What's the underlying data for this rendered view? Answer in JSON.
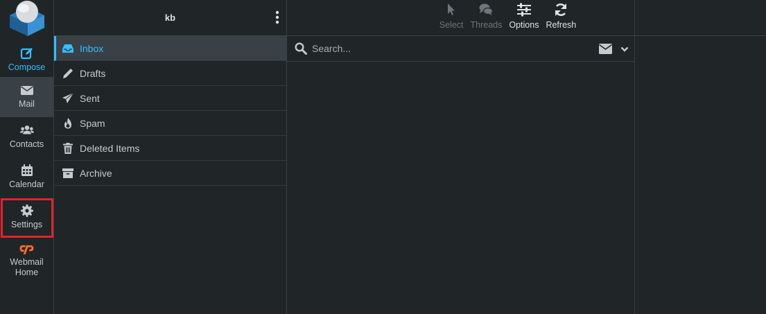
{
  "nav": {
    "compose": "Compose",
    "mail": "Mail",
    "contacts": "Contacts",
    "calendar": "Calendar",
    "settings": "Settings",
    "webmail_home": "Webmail\nHome"
  },
  "folders": {
    "title": "kb",
    "items": [
      {
        "label": "Inbox",
        "icon": "inbox-icon",
        "selected": true
      },
      {
        "label": "Drafts",
        "icon": "pencil-icon"
      },
      {
        "label": "Sent",
        "icon": "paper-plane-icon"
      },
      {
        "label": "Spam",
        "icon": "fire-icon"
      },
      {
        "label": "Deleted Items",
        "icon": "trash-icon"
      },
      {
        "label": "Archive",
        "icon": "archive-box-icon"
      }
    ]
  },
  "toolbar": {
    "select": "Select",
    "threads": "Threads",
    "options": "Options",
    "refresh": "Refresh"
  },
  "search": {
    "placeholder": "Search..."
  },
  "colors": {
    "accent": "#37beff",
    "background": "#202528",
    "selected_bg": "#394147",
    "highlight_border": "#e0242c",
    "cpanel_orange": "#ff6c2c"
  }
}
